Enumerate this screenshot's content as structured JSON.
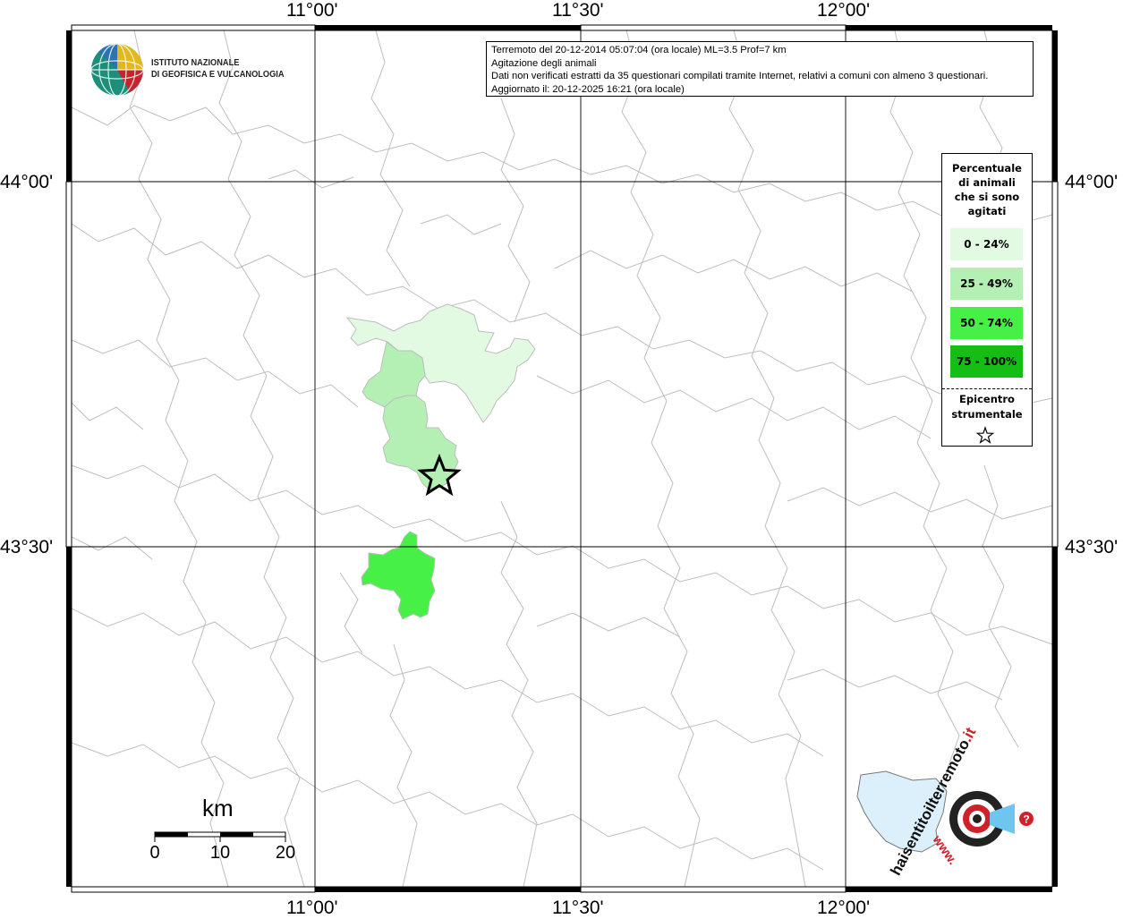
{
  "info": {
    "line1": "Terremoto del 20-12-2014 05:07:04 (ora locale) ML=3.5 Prof=7 km",
    "line2": "Agitazione degli animali",
    "line3": "Dati non verificati estratti da 35 questionari compilati tramite Internet, relativi a comuni con almeno 3 questionari.",
    "line4": "Aggiornato il: 20-12-2025 16:21 (ora locale)"
  },
  "logo": {
    "line1": "ISTITUTO NAZIONALE",
    "line2": "DI GEOFISICA E VULCANOLOGIA"
  },
  "axes": {
    "lon_top": [
      "11°00'",
      "11°30'",
      "12°00'"
    ],
    "lon_bottom": [
      "11°00'",
      "11°30'",
      "12°00'"
    ],
    "lat_left": [
      "44°00'",
      "43°30'"
    ],
    "lat_right": [
      "44°00'",
      "43°30'"
    ]
  },
  "legend": {
    "title_lines": [
      "Percentuale",
      "di animali",
      "che si sono",
      "agitati"
    ],
    "items": [
      {
        "label": "0 - 24%",
        "color": "#e1fae1"
      },
      {
        "label": "25 - 49%",
        "color": "#b4f0b4"
      },
      {
        "label": "50 - 74%",
        "color": "#46f046"
      },
      {
        "label": "75 - 100%",
        "color": "#14be14"
      }
    ],
    "epicenter_lines": [
      "Epicentro",
      "strumentale"
    ]
  },
  "scale": {
    "unit": "km",
    "ticks": [
      "0",
      "10",
      "20"
    ]
  },
  "watermark": {
    "text_main": "haisentitoilterremoto",
    "text_it": ".it",
    "text_www": "www.",
    "question": "?"
  },
  "colors": {
    "frame": "#000000",
    "grid": "#000000",
    "boundaries": "#bdbdbd",
    "class_0_24": "#e1fae1",
    "class_25_49": "#b4f0b4",
    "class_50_74": "#46f046",
    "class_75_100": "#14be14"
  }
}
